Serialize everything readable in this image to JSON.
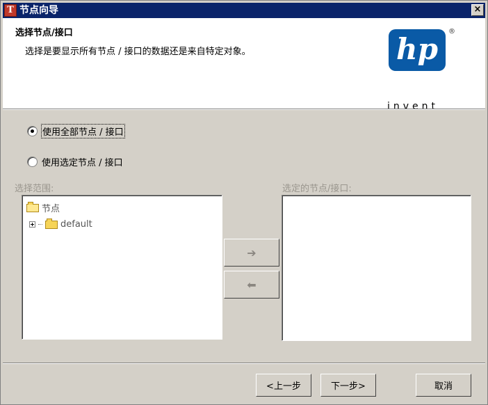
{
  "window": {
    "title": "节点向导",
    "app_icon": "T",
    "close_glyph": "×"
  },
  "header": {
    "title": "选择节点/接口",
    "description": "选择是要显示所有节点 / 接口的数据还是来自特定对象。",
    "logo": {
      "text": "hp",
      "registered": "®",
      "tagline": "invent",
      "color": "#0a5aa6"
    }
  },
  "options": {
    "use_all": {
      "label": "使用全部节点 / 接口",
      "checked": true
    },
    "use_selected": {
      "label": "使用选定节点 / 接口",
      "checked": false
    }
  },
  "left_panel": {
    "label": "选择范围:",
    "tree": [
      {
        "label": "节点",
        "icon": "folder-open-icon"
      },
      {
        "label": "default",
        "icon": "folder-icon",
        "expander": "plus"
      }
    ]
  },
  "right_panel": {
    "label": "选定的节点/接口:"
  },
  "transfer": {
    "add_glyph": "➔",
    "remove_glyph": "⬅"
  },
  "footer": {
    "back": "<上一步",
    "next": "下一步>",
    "cancel": "取消"
  }
}
